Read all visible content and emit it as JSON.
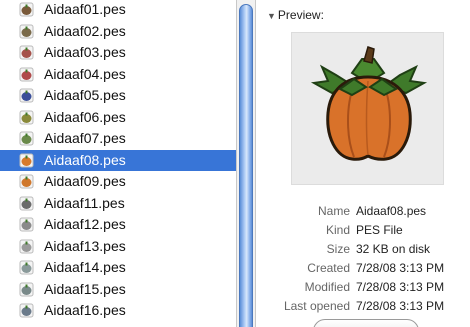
{
  "files": [
    {
      "name": "Aidaaf01.pes",
      "icon": "pes-thumbnail-icon",
      "color": "#7a5a3a"
    },
    {
      "name": "Aidaaf02.pes",
      "icon": "pes-thumbnail-icon",
      "color": "#7a6a4a"
    },
    {
      "name": "Aidaaf03.pes",
      "icon": "pes-thumbnail-icon",
      "color": "#a5514a"
    },
    {
      "name": "Aidaaf04.pes",
      "icon": "pes-thumbnail-icon",
      "color": "#b04a4a"
    },
    {
      "name": "Aidaaf05.pes",
      "icon": "pes-thumbnail-icon",
      "color": "#3a4f9a"
    },
    {
      "name": "Aidaaf06.pes",
      "icon": "pes-thumbnail-icon",
      "color": "#8a8a3a"
    },
    {
      "name": "Aidaaf07.pes",
      "icon": "pes-thumbnail-icon",
      "color": "#6a8a4a"
    },
    {
      "name": "Aidaaf08.pes",
      "icon": "pes-thumbnail-icon",
      "color": "#d87a2a"
    },
    {
      "name": "Aidaaf09.pes",
      "icon": "pes-thumbnail-icon",
      "color": "#d0782c"
    },
    {
      "name": "Aidaaf11.pes",
      "icon": "pes-thumbnail-icon",
      "color": "#6a6a6a"
    },
    {
      "name": "Aidaaf12.pes",
      "icon": "pes-thumbnail-icon",
      "color": "#8a8a8a"
    },
    {
      "name": "Aidaaf13.pes",
      "icon": "pes-thumbnail-icon",
      "color": "#9a9a9a"
    },
    {
      "name": "Aidaaf14.pes",
      "icon": "pes-thumbnail-icon",
      "color": "#8a9a9a"
    },
    {
      "name": "Aidaaf15.pes",
      "icon": "pes-thumbnail-icon",
      "color": "#7a8a8a"
    },
    {
      "name": "Aidaaf16.pes",
      "icon": "pes-thumbnail-icon",
      "color": "#6a7a8a"
    }
  ],
  "selected_index": 7,
  "preview": {
    "header": "Preview:",
    "info": [
      {
        "key": "Name",
        "value": "Aidaaf08.pes"
      },
      {
        "key": "Kind",
        "value": "PES File"
      },
      {
        "key": "Size",
        "value": "32 KB on disk"
      },
      {
        "key": "Created",
        "value": "7/28/08 3:13 PM"
      },
      {
        "key": "Modified",
        "value": "7/28/08 3:13 PM"
      },
      {
        "key": "Last opened",
        "value": "7/28/08 3:13 PM"
      }
    ]
  },
  "colors": {
    "selection": "#3875d7",
    "pumpkin": "#d9722a",
    "leaf": "#3f7a2a"
  }
}
